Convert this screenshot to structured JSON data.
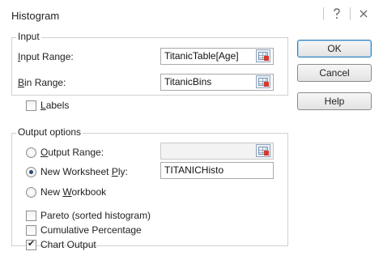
{
  "dialog": {
    "title": "Histogram",
    "help_icon": "question-icon",
    "close_icon": "close-icon"
  },
  "input": {
    "group_label": "Input",
    "input_range_label": "Input Range:",
    "input_range_value": "TitanicTable[Age]",
    "bin_range_label": "Bin Range:",
    "bin_range_value": "TitanicBins",
    "labels_label": "Labels",
    "labels_checked": false
  },
  "output": {
    "group_label": "Output options",
    "output_range_label": "Output Range:",
    "output_range_value": "",
    "new_worksheet_label": "New Worksheet Ply:",
    "new_worksheet_value": "TITANICHisto",
    "new_workbook_label": "New Workbook",
    "selected_option": "new_worksheet",
    "pareto_label": "Pareto (sorted histogram)",
    "pareto_checked": false,
    "cumulative_label": "Cumulative Percentage",
    "cumulative_checked": false,
    "chart_output_label": "Chart Output",
    "chart_output_checked": true
  },
  "buttons": {
    "ok": "OK",
    "cancel": "Cancel",
    "help": "Help"
  }
}
